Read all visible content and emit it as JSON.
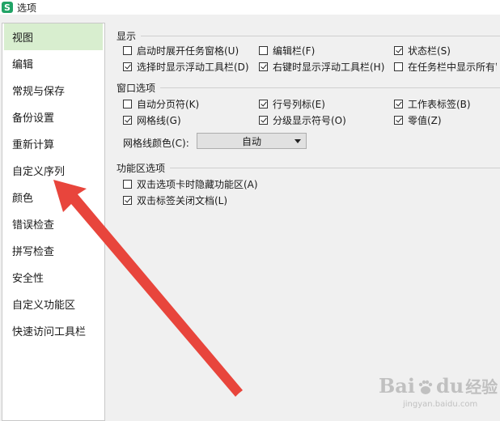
{
  "window": {
    "title": "选项",
    "logo_letter": "S"
  },
  "sidebar": {
    "items": [
      {
        "label": "视图",
        "active": true
      },
      {
        "label": "编辑"
      },
      {
        "label": "常规与保存"
      },
      {
        "label": "备份设置"
      },
      {
        "label": "重新计算"
      },
      {
        "label": "自定义序列"
      },
      {
        "label": "颜色"
      },
      {
        "label": "错误检查"
      },
      {
        "label": "拼写检查"
      },
      {
        "label": "安全性"
      },
      {
        "label": "自定义功能区"
      },
      {
        "label": "快速访问工具栏"
      }
    ]
  },
  "display": {
    "title": "显示",
    "options": [
      {
        "label": "启动时展开任务窗格(U)",
        "checked": false
      },
      {
        "label": "编辑栏(F)",
        "checked": false
      },
      {
        "label": "状态栏(S)",
        "checked": true
      },
      {
        "label": "选择时显示浮动工具栏(D)",
        "checked": true
      },
      {
        "label": "右键时显示浮动工具栏(H)",
        "checked": true
      },
      {
        "label": "在任务栏中显示所有窗",
        "checked": false
      }
    ]
  },
  "window_options": {
    "title": "窗口选项",
    "options": [
      {
        "label": "自动分页符(K)",
        "checked": false
      },
      {
        "label": "行号列标(E)",
        "checked": true
      },
      {
        "label": "工作表标签(B)",
        "checked": true
      },
      {
        "label": "网格线(G)",
        "checked": true
      },
      {
        "label": "分级显示符号(O)",
        "checked": true
      },
      {
        "label": "零值(Z)",
        "checked": true
      }
    ],
    "grid_color_label": "网格线颜色(C):",
    "grid_color_value": "自动"
  },
  "ribbon": {
    "title": "功能区选项",
    "options": [
      {
        "label": "双击选项卡时隐藏功能区(A)",
        "checked": false
      },
      {
        "label": "双击标签关闭文档(L)",
        "checked": true
      }
    ]
  },
  "watermark": {
    "brand": "Bai",
    "brand_end": "du",
    "cn": "经验",
    "url": "jingyan.baidu.com"
  },
  "colors": {
    "active_nav": "#d8eecf",
    "arrow": "#e8453c",
    "logo": "#21a366"
  }
}
